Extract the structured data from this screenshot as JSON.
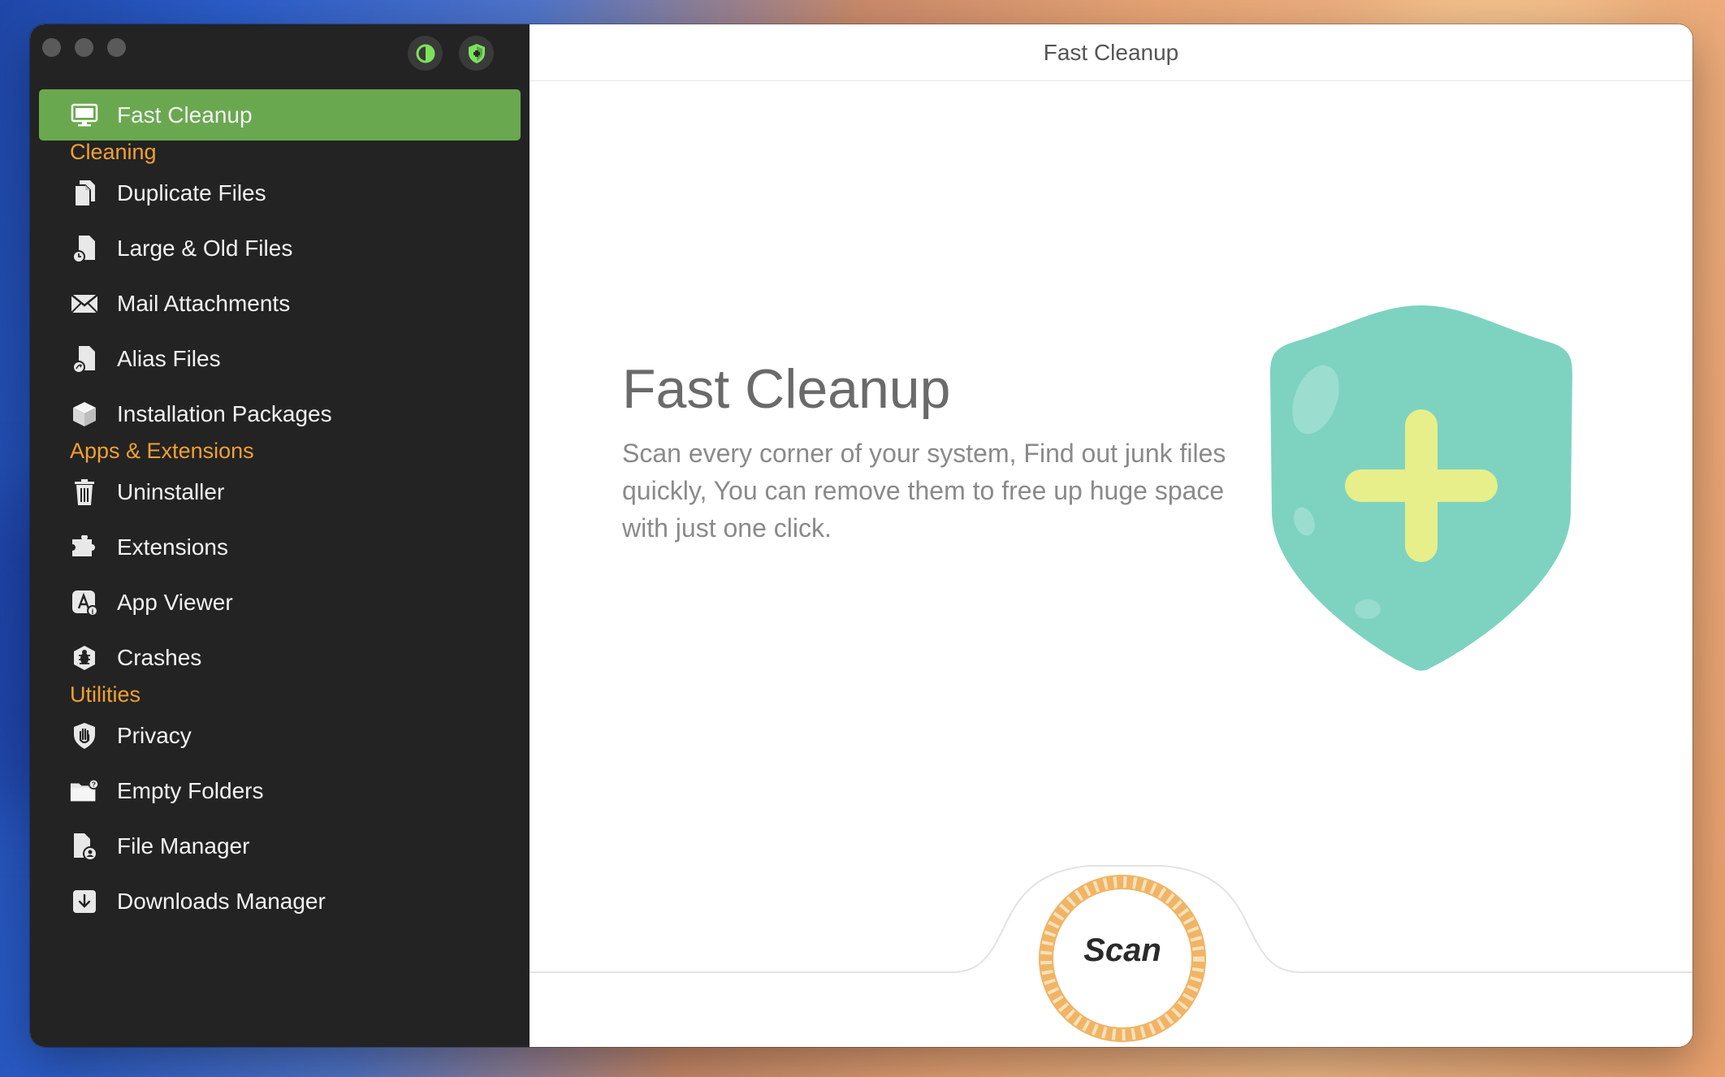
{
  "window": {
    "title": "Fast Cleanup"
  },
  "toolbar": {
    "theme_icon": "contrast-icon",
    "protect_icon": "shield-icon"
  },
  "sidebar": {
    "active": {
      "label": "Fast Cleanup",
      "icon": "monitor-icon"
    },
    "sections": [
      {
        "title": "Cleaning",
        "items": [
          {
            "label": "Duplicate Files",
            "icon": "duplicate-files-icon"
          },
          {
            "label": "Large & Old Files",
            "icon": "large-files-icon"
          },
          {
            "label": "Mail Attachments",
            "icon": "mail-icon"
          },
          {
            "label": "Alias Files",
            "icon": "alias-file-icon"
          },
          {
            "label": "Installation Packages",
            "icon": "package-icon"
          }
        ]
      },
      {
        "title": "Apps & Extensions",
        "items": [
          {
            "label": "Uninstaller",
            "icon": "trash-icon"
          },
          {
            "label": "Extensions",
            "icon": "puzzle-icon"
          },
          {
            "label": "App Viewer",
            "icon": "app-viewer-icon"
          },
          {
            "label": "Crashes",
            "icon": "bug-icon"
          }
        ]
      },
      {
        "title": "Utilities",
        "items": [
          {
            "label": "Privacy",
            "icon": "hand-shield-icon"
          },
          {
            "label": "Empty Folders",
            "icon": "folder-icon"
          },
          {
            "label": "File Manager",
            "icon": "file-user-icon"
          },
          {
            "label": "Downloads Manager",
            "icon": "download-icon"
          }
        ]
      }
    ]
  },
  "main": {
    "headline": "Fast Cleanup",
    "description": "Scan every corner of your system, Find out junk files quickly, You can remove them to free up huge space with just one click.",
    "scan_label": "Scan"
  },
  "colors": {
    "accent_green": "#6aa84f",
    "section_orange": "#f0a035",
    "shield_teal": "#7dd3c0",
    "plus_yellow": "#e6ef8a",
    "scan_ring": "#f0b466"
  }
}
